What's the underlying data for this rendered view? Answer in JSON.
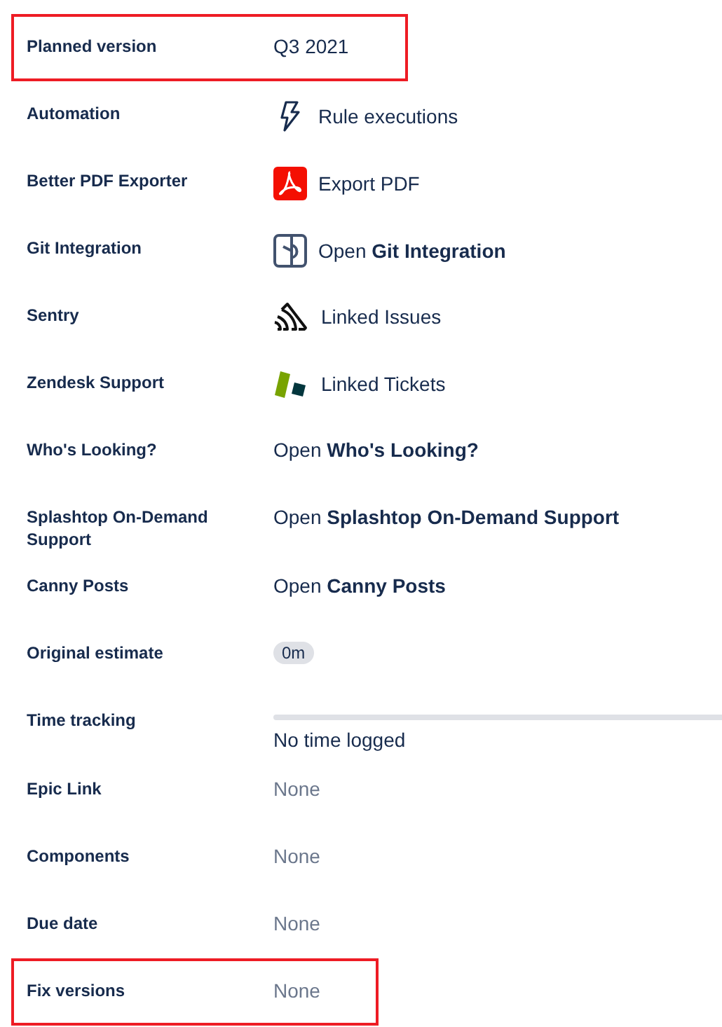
{
  "fields": [
    {
      "label": "Planned version",
      "highlighted": true,
      "value": {
        "kind": "text",
        "text": "Q3 2021"
      }
    },
    {
      "label": "Automation",
      "highlighted": false,
      "value": {
        "kind": "bolt",
        "text": "Rule executions"
      }
    },
    {
      "label": "Better PDF Exporter",
      "highlighted": false,
      "value": {
        "kind": "pdf",
        "text": "Export PDF"
      }
    },
    {
      "label": "Git Integration",
      "highlighted": false,
      "value": {
        "kind": "git",
        "text": "Open **Git Integration**"
      }
    },
    {
      "label": "Sentry",
      "highlighted": false,
      "value": {
        "kind": "sentry",
        "text": "Linked Issues"
      }
    },
    {
      "label": "Zendesk Support",
      "highlighted": false,
      "value": {
        "kind": "zendesk",
        "text": "Linked Tickets"
      }
    },
    {
      "label": "Who's Looking?",
      "highlighted": false,
      "value": {
        "kind": "link",
        "text": "Open **Who's Looking?**"
      }
    },
    {
      "label": "Splashtop On-Demand Support",
      "highlighted": false,
      "value": {
        "kind": "link",
        "text": "Open **Splashtop On-Demand Support**"
      }
    },
    {
      "label": "Canny Posts",
      "highlighted": false,
      "value": {
        "kind": "link",
        "text": "Open **Canny Posts**"
      }
    },
    {
      "label": "Original estimate",
      "highlighted": false,
      "value": {
        "kind": "badge",
        "text": "0m"
      }
    },
    {
      "label": "Time tracking",
      "highlighted": false,
      "value": {
        "kind": "tracking",
        "text": "No time logged"
      }
    },
    {
      "label": "Epic Link",
      "highlighted": false,
      "value": {
        "kind": "none",
        "text": "None"
      }
    },
    {
      "label": "Components",
      "highlighted": false,
      "value": {
        "kind": "none",
        "text": "None"
      }
    },
    {
      "label": "Due date",
      "highlighted": false,
      "value": {
        "kind": "none",
        "text": "None"
      }
    },
    {
      "label": "Fix versions",
      "highlighted": true,
      "value": {
        "kind": "none",
        "text": "None"
      }
    }
  ]
}
